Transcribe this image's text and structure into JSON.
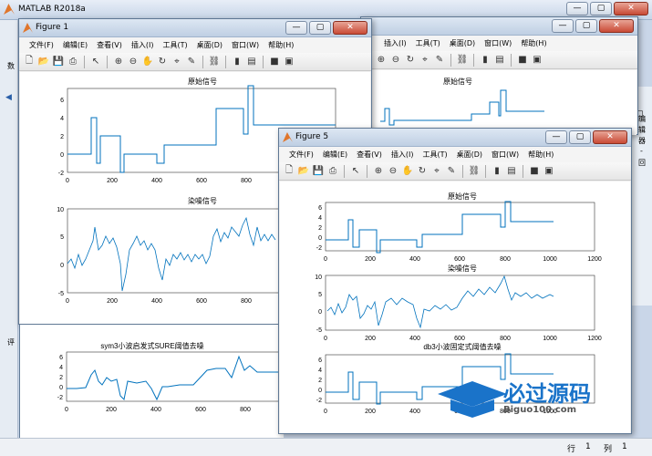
{
  "main_window": {
    "title": "MATLAB R2018a",
    "buttons": [
      "—",
      "▢",
      "✕"
    ]
  },
  "status": {
    "row_label": "行",
    "row_value": "1",
    "col_label": "列",
    "col_value": "1"
  },
  "left_edge_chars": [
    "数",
    "评"
  ],
  "right_edge_chars": [
    "编",
    "辑",
    "器",
    "-",
    "回"
  ],
  "watermark": {
    "brand": "必过源码",
    "url": "Biguo100.com"
  },
  "figure1": {
    "title": "Figure 1",
    "menu": [
      "文件(F)",
      "编辑(E)",
      "查看(V)",
      "插入(I)",
      "工具(T)",
      "桌面(D)",
      "窗口(W)",
      "帮助(H)"
    ],
    "plots": [
      {
        "title": "原始信号",
        "yticks": [
          "-2",
          "0",
          "2",
          "4",
          "6"
        ],
        "xticks": [
          "0",
          "200",
          "400",
          "600",
          "800"
        ]
      },
      {
        "title": "染噪信号",
        "yticks": [
          "-5",
          "0",
          "5",
          "10"
        ],
        "xticks": [
          "0",
          "200",
          "400",
          "600",
          "800"
        ]
      },
      {
        "title": "sym3小波启发式SURE阈值去噪",
        "yticks": [
          "-2",
          "0",
          "2",
          "4",
          "6"
        ],
        "xticks": [
          "0",
          "200",
          "400",
          "600",
          "800"
        ]
      }
    ]
  },
  "figure_back": {
    "menu": [
      "插入(I)",
      "工具(T)",
      "桌面(D)",
      "窗口(W)",
      "帮助(H)"
    ],
    "plot_title": "原始信号"
  },
  "figure5": {
    "title": "Figure 5",
    "menu": [
      "文件(F)",
      "编辑(E)",
      "查看(V)",
      "插入(I)",
      "工具(T)",
      "桌面(D)",
      "窗口(W)",
      "帮助(H)"
    ],
    "plots": [
      {
        "title": "原始信号",
        "yticks": [
          "-2",
          "0",
          "2",
          "4",
          "6"
        ],
        "xticks": [
          "0",
          "200",
          "400",
          "600",
          "800",
          "1000",
          "1200"
        ]
      },
      {
        "title": "染噪信号",
        "yticks": [
          "-5",
          "0",
          "5",
          "10"
        ],
        "xticks": [
          "0",
          "200",
          "400",
          "600",
          "800",
          "1000",
          "1200"
        ]
      },
      {
        "title": "db3小波固定式阈值去噪",
        "yticks": [
          "-2",
          "0",
          "2",
          "4",
          "6"
        ],
        "xticks": [
          "0",
          "200",
          "400",
          "600",
          "800",
          "1000"
        ]
      }
    ]
  },
  "colors": {
    "line": "#0072bd",
    "title_bg": "#c7d5e8",
    "figure_bg": "#f0f0f0"
  }
}
